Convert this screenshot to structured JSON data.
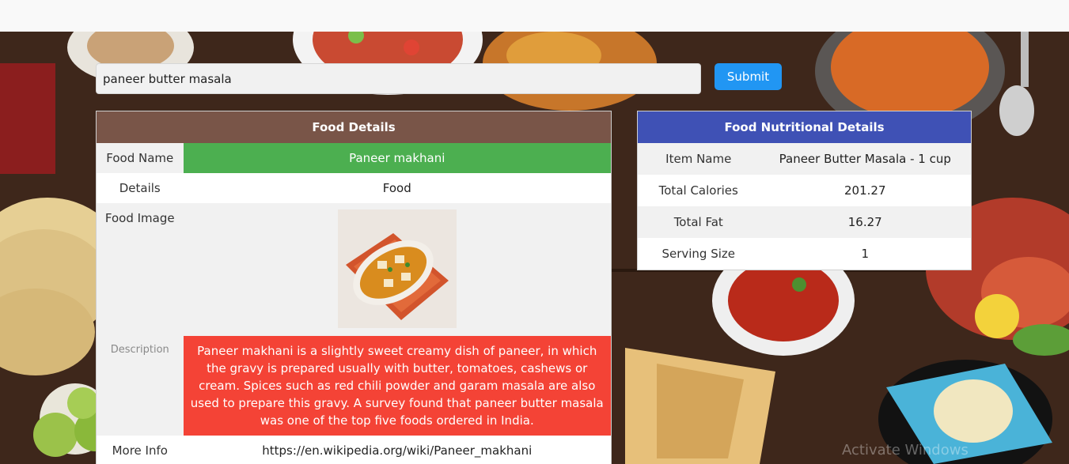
{
  "search": {
    "value": "paneer butter masala",
    "submit_label": "Submit"
  },
  "food_details": {
    "header": "Food Details",
    "rows": {
      "name_label": "Food Name",
      "name_value": "Paneer makhani",
      "details_label": "Details",
      "details_value": "Food",
      "image_label": "Food Image",
      "description_label": "Description",
      "description_value": "Paneer makhani is a slightly sweet creamy dish of paneer, in which the gravy is prepared usually with butter, tomatoes, cashews or cream. Spices such as red chili powder and garam masala are also used to prepare this gravy. A survey found that paneer butter masala was one of the top five foods ordered in India.",
      "more_info_label": "More Info",
      "more_info_value": "https://en.wikipedia.org/wiki/Paneer_makhani"
    }
  },
  "nutrition": {
    "header": "Food Nutritional Details",
    "rows": [
      {
        "label": "Item Name",
        "value": "Paneer Butter Masala - 1 cup"
      },
      {
        "label": "Total Calories",
        "value": "201.27"
      },
      {
        "label": "Total Fat",
        "value": "16.27"
      },
      {
        "label": "Serving Size",
        "value": "1"
      }
    ]
  },
  "watermark": "Activate Windows",
  "colors": {
    "submit": "#2196f3",
    "food_header": "#795548",
    "nutrition_header": "#3f51b5",
    "name_cell": "#4caf50",
    "description_cell": "#f44336"
  }
}
